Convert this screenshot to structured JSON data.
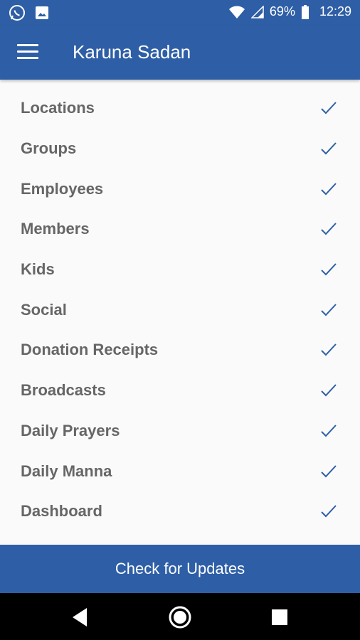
{
  "status_bar": {
    "battery_percent": "69%",
    "time": "12:29"
  },
  "app_bar": {
    "title": "Karuna Sadan"
  },
  "menu": {
    "items": [
      {
        "label": "Locations",
        "checked": true
      },
      {
        "label": "Groups",
        "checked": true
      },
      {
        "label": "Employees",
        "checked": true
      },
      {
        "label": "Members",
        "checked": true
      },
      {
        "label": "Kids",
        "checked": true
      },
      {
        "label": "Social",
        "checked": true
      },
      {
        "label": "Donation Receipts",
        "checked": true
      },
      {
        "label": "Broadcasts",
        "checked": true
      },
      {
        "label": "Daily Prayers",
        "checked": true
      },
      {
        "label": "Daily Manna",
        "checked": true
      },
      {
        "label": "Dashboard",
        "checked": true
      }
    ]
  },
  "footer": {
    "button_label": "Check for Updates"
  },
  "colors": {
    "primary": "#2e5fa6",
    "text": "#666666",
    "background": "#fafafa",
    "check": "#2e5fa6"
  }
}
